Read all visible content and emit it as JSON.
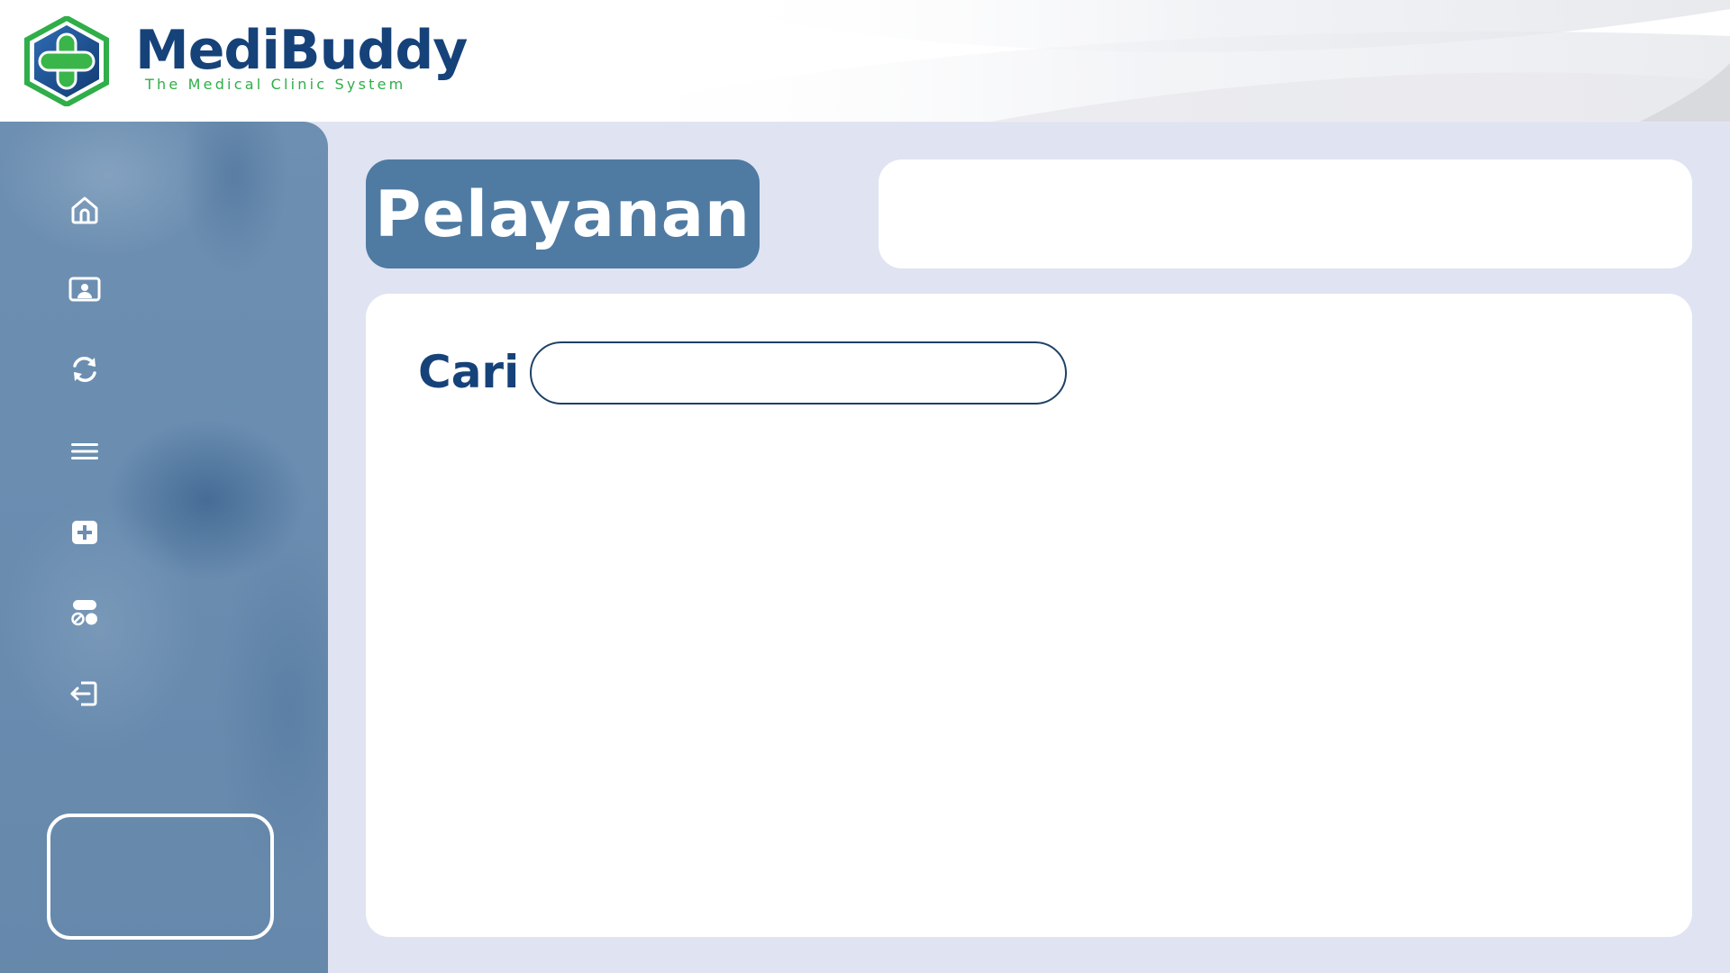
{
  "app": {
    "name": "MediBuddy",
    "tagline": "The Medical Clinic System"
  },
  "colors": {
    "brand_blue": "#16427a",
    "brand_green": "#2fae49",
    "sidebar": "#6a8db0",
    "title_pill": "#4f7aa2",
    "background": "#dfe3f2"
  },
  "sidebar": {
    "items": [
      {
        "id": "home",
        "icon": "home-icon"
      },
      {
        "id": "profile",
        "icon": "user-card-icon"
      },
      {
        "id": "sync",
        "icon": "refresh-icon"
      },
      {
        "id": "menu",
        "icon": "menu-icon"
      },
      {
        "id": "medical",
        "icon": "medical-plus-icon"
      },
      {
        "id": "services",
        "icon": "pills-icon"
      },
      {
        "id": "logout",
        "icon": "logout-icon"
      }
    ]
  },
  "main": {
    "title": "Pelayanan",
    "search": {
      "label": "Cari",
      "value": "",
      "placeholder": ""
    }
  }
}
